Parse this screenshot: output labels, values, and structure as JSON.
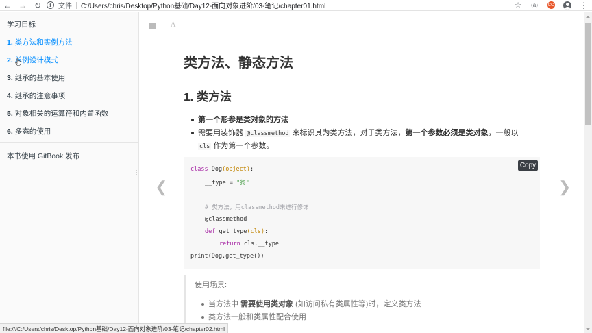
{
  "browser": {
    "protocol_label": "文件",
    "url": "C:/Users/chris/Desktop/Python基础/Day12-面向对象进阶/03-笔记/chapter01.html",
    "extension_badge": "CC"
  },
  "sidebar": {
    "title": "学习目标",
    "items": [
      {
        "num": "1.",
        "label": "类方法和实例方法"
      },
      {
        "num": "2.",
        "label": "单例设计模式"
      },
      {
        "num": "3.",
        "label": "继承的基本使用"
      },
      {
        "num": "4.",
        "label": "继承的注意事项"
      },
      {
        "num": "5.",
        "label": "对象相关的运算符和内置函数"
      },
      {
        "num": "6.",
        "label": "多态的使用"
      }
    ],
    "footer": "本书使用 GitBook 发布"
  },
  "content": {
    "h1": "类方法、静态方法",
    "h2": "1. 类方法",
    "bullet1": "第一个形参是类对象的方法",
    "bullet2_a": "需要用装饰器 ",
    "bullet2_code": "@classmethod",
    "bullet2_b": " 来标识其为类方法，对于类方法，",
    "bullet2_bold": "第一个参数必须是类对象",
    "bullet2_c": "，一般以 ",
    "bullet2_code2": "cls",
    "bullet2_d": " 作为第一个参数。",
    "code": {
      "l1_kw": "class",
      "l1_name": " Dog",
      "l1_paren": "(object)",
      "l1_end": ":",
      "l2": "__type = ",
      "l2_str": "\"狗\"",
      "l3": "# 类方法，用classmethod来进行修饰",
      "l4": "@classmethod",
      "l5_kw": "def",
      "l5_name": " get_type",
      "l5_paren": "(cls)",
      "l5_end": ":",
      "l6_kw": "return",
      "l6_rest": " cls.__type",
      "l7": "print(Dog.get_type())"
    },
    "copy_label": "Copy",
    "quote_title": "使用场景:",
    "quote_item1_a": "当方法中 ",
    "quote_item1_bold": "需要使用类对象",
    "quote_item1_b": " (如访问私有类属性等)时，定义类方法",
    "quote_item2": "类方法一般和类属性配合使用"
  },
  "status_url": "file:///C:/Users/chris/Desktop/Python基础/Day12-面向对象进阶/03-笔记/chapter02.html"
}
